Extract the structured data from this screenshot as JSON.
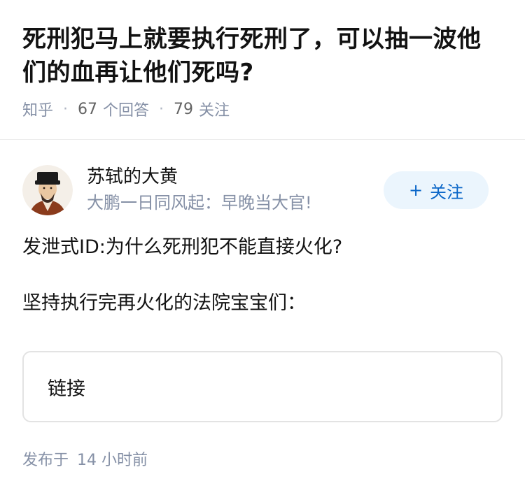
{
  "question": {
    "title": "死刑犯马上就要执行死刑了，可以抽一波他们的血再让他们死吗?",
    "source": "知乎",
    "answers_count": "67",
    "answers_label": "个回答",
    "followers_count": "79",
    "followers_label": "关注"
  },
  "author": {
    "name": "苏轼的大黄",
    "bio": "大鹏一日同风起：早晚当大官!",
    "follow_label": "关注",
    "follow_icon": "plus-icon"
  },
  "answer": {
    "paragraphs": [
      "发泄式ID:为什么死刑犯不能直接火化?",
      "坚持执行完再火化的法院宝宝们："
    ],
    "link_label": "链接",
    "published_prefix": "发布于",
    "published_time": "14 小时前"
  },
  "colors": {
    "meta": "#8590a6",
    "follow_bg": "#ebf5fd",
    "follow_text": "#0a66c8"
  }
}
